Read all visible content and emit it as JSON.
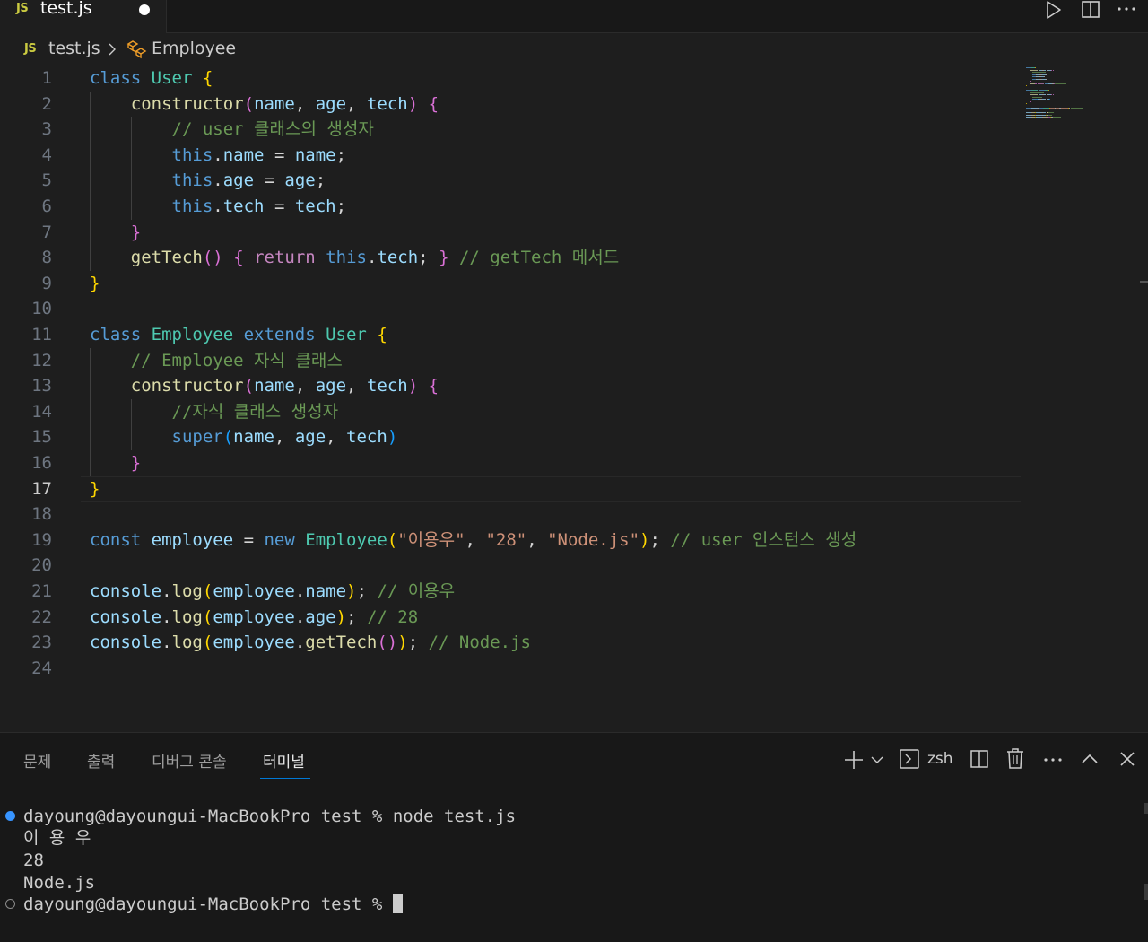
{
  "colors": {
    "keyword": "#569cd6",
    "class_name": "#4ec9b0",
    "function": "#dcdcaa",
    "variable": "#9cdcfe",
    "string": "#ce9178",
    "comment": "#6a9955",
    "punct": "#d4d4d4",
    "bracket1": "#ffd700",
    "bracket2": "#da70d6",
    "bracket3": "#179fff",
    "control": "#c586c0",
    "js_badge": "#cbcb41",
    "accent": "#0078d4"
  },
  "tab": {
    "badge": "JS",
    "filename": "test.js"
  },
  "breadcrumb": {
    "badge": "JS",
    "file": "test.js",
    "symbol": "Employee"
  },
  "active_line": 17,
  "lines": [
    [
      [
        "kw",
        "class "
      ],
      [
        "cls",
        "User "
      ],
      [
        "b1",
        "{"
      ]
    ],
    [
      [
        "p",
        "    "
      ],
      [
        "fn",
        "constructor"
      ],
      [
        "b2",
        "("
      ],
      [
        "var",
        "name"
      ],
      [
        "p",
        ", "
      ],
      [
        "var",
        "age"
      ],
      [
        "p",
        ", "
      ],
      [
        "var",
        "tech"
      ],
      [
        "b2",
        ")"
      ],
      [
        "p",
        " "
      ],
      [
        "b2",
        "{"
      ]
    ],
    [
      [
        "p",
        "        "
      ],
      [
        "cm",
        "// user 클래스의 생성자"
      ]
    ],
    [
      [
        "p",
        "        "
      ],
      [
        "kw",
        "this"
      ],
      [
        "p",
        "."
      ],
      [
        "var",
        "name"
      ],
      [
        "p",
        " = "
      ],
      [
        "var",
        "name"
      ],
      [
        "p",
        ";"
      ]
    ],
    [
      [
        "p",
        "        "
      ],
      [
        "kw",
        "this"
      ],
      [
        "p",
        "."
      ],
      [
        "var",
        "age"
      ],
      [
        "p",
        " = "
      ],
      [
        "var",
        "age"
      ],
      [
        "p",
        ";"
      ]
    ],
    [
      [
        "p",
        "        "
      ],
      [
        "kw",
        "this"
      ],
      [
        "p",
        "."
      ],
      [
        "var",
        "tech"
      ],
      [
        "p",
        " = "
      ],
      [
        "var",
        "tech"
      ],
      [
        "p",
        ";"
      ]
    ],
    [
      [
        "p",
        "    "
      ],
      [
        "b2",
        "}"
      ]
    ],
    [
      [
        "p",
        "    "
      ],
      [
        "fn",
        "getTech"
      ],
      [
        "b2",
        "()"
      ],
      [
        "p",
        " "
      ],
      [
        "b2",
        "{"
      ],
      [
        "p",
        " "
      ],
      [
        "ctl",
        "return"
      ],
      [
        "p",
        " "
      ],
      [
        "kw",
        "this"
      ],
      [
        "p",
        "."
      ],
      [
        "var",
        "tech"
      ],
      [
        "p",
        "; "
      ],
      [
        "b2",
        "}"
      ],
      [
        "p",
        " "
      ],
      [
        "cm",
        "// getTech 메서드"
      ]
    ],
    [
      [
        "b1",
        "}"
      ]
    ],
    [],
    [
      [
        "kw",
        "class "
      ],
      [
        "cls",
        "Employee "
      ],
      [
        "kw",
        "extends "
      ],
      [
        "cls",
        "User "
      ],
      [
        "b1",
        "{"
      ]
    ],
    [
      [
        "p",
        "    "
      ],
      [
        "cm",
        "// Employee 자식 클래스"
      ]
    ],
    [
      [
        "p",
        "    "
      ],
      [
        "fn",
        "constructor"
      ],
      [
        "b2",
        "("
      ],
      [
        "var",
        "name"
      ],
      [
        "p",
        ", "
      ],
      [
        "var",
        "age"
      ],
      [
        "p",
        ", "
      ],
      [
        "var",
        "tech"
      ],
      [
        "b2",
        ")"
      ],
      [
        "p",
        " "
      ],
      [
        "b2",
        "{"
      ]
    ],
    [
      [
        "p",
        "        "
      ],
      [
        "cm",
        "//자식 클래스 생성자"
      ]
    ],
    [
      [
        "p",
        "        "
      ],
      [
        "kw",
        "super"
      ],
      [
        "b3",
        "("
      ],
      [
        "var",
        "name"
      ],
      [
        "p",
        ", "
      ],
      [
        "var",
        "age"
      ],
      [
        "p",
        ", "
      ],
      [
        "var",
        "tech"
      ],
      [
        "b3",
        ")"
      ]
    ],
    [
      [
        "p",
        "    "
      ],
      [
        "b2",
        "}"
      ]
    ],
    [
      [
        "b1",
        "}"
      ]
    ],
    [],
    [
      [
        "kw",
        "const "
      ],
      [
        "var",
        "employee"
      ],
      [
        "p",
        " = "
      ],
      [
        "kw",
        "new "
      ],
      [
        "cls",
        "Employee"
      ],
      [
        "b1",
        "("
      ],
      [
        "str",
        "\"이용우\""
      ],
      [
        "p",
        ", "
      ],
      [
        "str",
        "\"28\""
      ],
      [
        "p",
        ", "
      ],
      [
        "str",
        "\"Node.js\""
      ],
      [
        "b1",
        ")"
      ],
      [
        "p",
        "; "
      ],
      [
        "cm",
        "// user 인스턴스 생성"
      ]
    ],
    [],
    [
      [
        "var",
        "console"
      ],
      [
        "p",
        "."
      ],
      [
        "fn",
        "log"
      ],
      [
        "b1",
        "("
      ],
      [
        "var",
        "employee"
      ],
      [
        "p",
        "."
      ],
      [
        "var",
        "name"
      ],
      [
        "b1",
        ")"
      ],
      [
        "p",
        "; "
      ],
      [
        "cm",
        "// 이용우"
      ]
    ],
    [
      [
        "var",
        "console"
      ],
      [
        "p",
        "."
      ],
      [
        "fn",
        "log"
      ],
      [
        "b1",
        "("
      ],
      [
        "var",
        "employee"
      ],
      [
        "p",
        "."
      ],
      [
        "var",
        "age"
      ],
      [
        "b1",
        ")"
      ],
      [
        "p",
        "; "
      ],
      [
        "cm",
        "// 28"
      ]
    ],
    [
      [
        "var",
        "console"
      ],
      [
        "p",
        "."
      ],
      [
        "fn",
        "log"
      ],
      [
        "b1",
        "("
      ],
      [
        "var",
        "employee"
      ],
      [
        "p",
        "."
      ],
      [
        "fn",
        "getTech"
      ],
      [
        "b2",
        "()"
      ],
      [
        "b1",
        ")"
      ],
      [
        "p",
        "; "
      ],
      [
        "cm",
        "// Node.js"
      ]
    ],
    []
  ],
  "panel": {
    "tabs": [
      "문제",
      "출력",
      "디버그 콘솔",
      "터미널"
    ],
    "active_tab": 3,
    "shell": "zsh"
  },
  "terminal": {
    "prompt": "dayoung@dayoungui-MacBookPro test % ",
    "command": "node test.js",
    "output": [
      "이 용 우",
      "28",
      "Node.js"
    ]
  }
}
